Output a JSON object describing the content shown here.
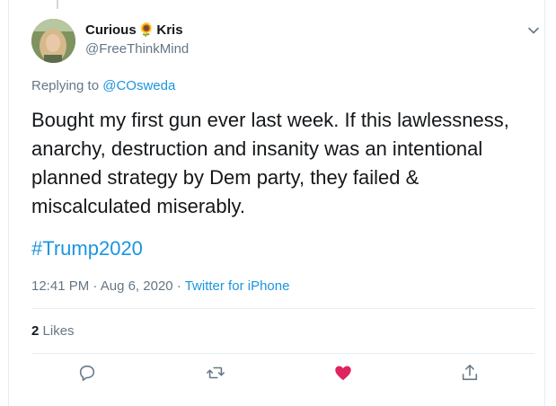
{
  "tweet": {
    "display_name_first": "Curious",
    "display_name_emoji": "🌻",
    "display_name_last": "Kris",
    "handle": "@FreeThinkMind",
    "replying_prefix": "Replying to",
    "replying_to": "@COsweda",
    "text": "Bought my first gun ever last week.  If this lawlessness,\nanarchy, destruction and insanity was an intentional\nplanned strategy by Dem party, they failed &\nmiscalculated miserably.",
    "hashtag": "#Trump2020",
    "time": "12:41 PM",
    "date": "Aug 6, 2020",
    "separator": "·",
    "source": "Twitter for iPhone",
    "likes_count": "2",
    "likes_label": "Likes"
  },
  "colors": {
    "link": "#1b95e0",
    "secondary_text": "#657786",
    "like_active": "#e0245e",
    "divider": "#e6ecf0"
  },
  "icons": [
    "chevron-down-icon",
    "reply-icon",
    "retweet-icon",
    "like-icon",
    "share-icon"
  ]
}
